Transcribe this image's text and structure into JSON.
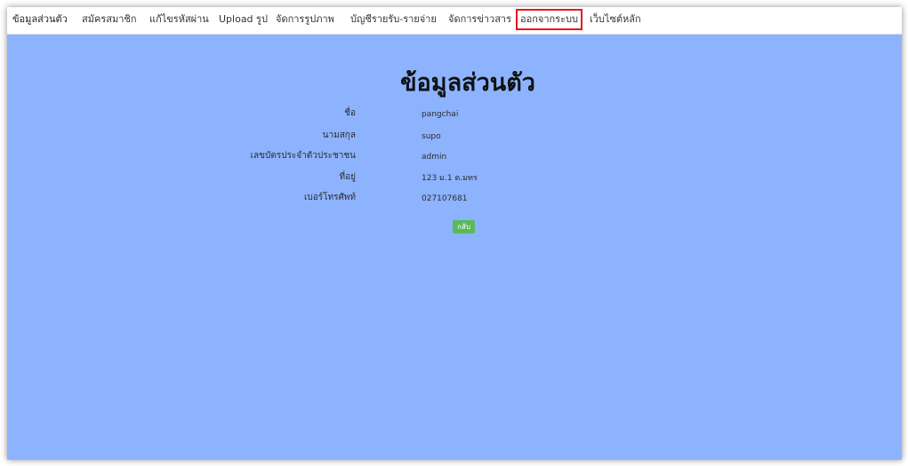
{
  "nav": {
    "items": [
      {
        "label": "ข้อมูลส่วนตัว"
      },
      {
        "label": "สมัครสมาชิก"
      },
      {
        "label": "แก้ไขรหัสผ่าน"
      },
      {
        "label": "Upload รูป"
      },
      {
        "label": "จัดการรูปภาพ"
      },
      {
        "label": "บัญชีรายรับ-รายจ่าย"
      },
      {
        "label": "จัดการข่าวสาร"
      },
      {
        "label": "ออกจากระบบ"
      },
      {
        "label": "เว็บไซต์หลัก"
      }
    ],
    "highlight_color": "#e8171d"
  },
  "main": {
    "title": "ข้อมูลส่วนตัว",
    "background_color": "#8db3ff",
    "fields": [
      {
        "label": "ชื่อ",
        "value": "pangchai"
      },
      {
        "label": "นามสกุล",
        "value": "supo"
      },
      {
        "label": "เลขบัตรประจำตัวประชาชน",
        "value": "admin"
      },
      {
        "label": "ที่อยู่",
        "value": "123 ม.1 ต.มทร"
      },
      {
        "label": "เบอร์โทรศัพท์",
        "value": "027107681"
      }
    ],
    "back_button_label": "กลับ",
    "back_button_color": "#5cb85c"
  }
}
